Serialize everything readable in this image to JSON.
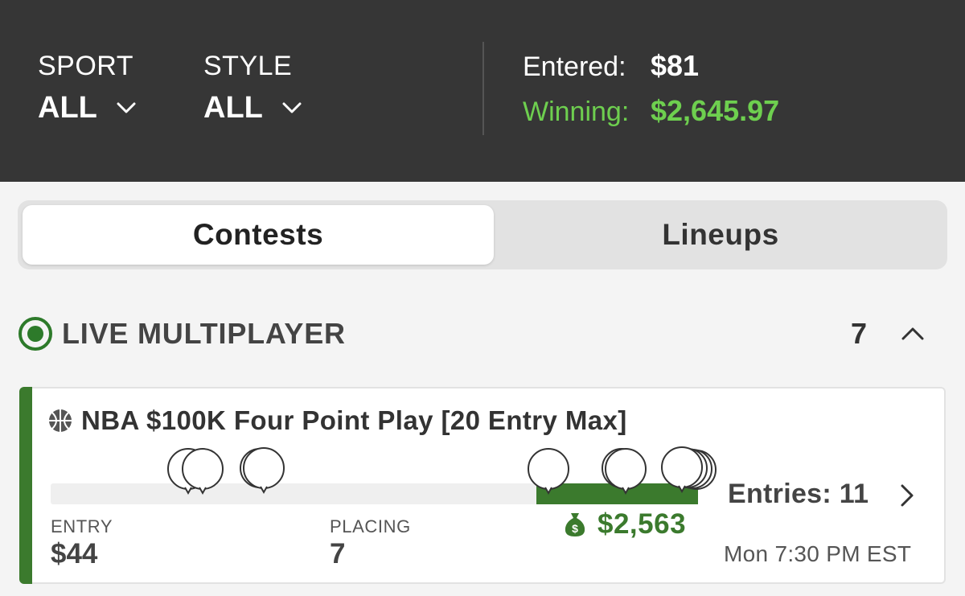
{
  "filters": {
    "sport": {
      "label": "SPORT",
      "value": "ALL",
      "icon": "chevron-down-icon"
    },
    "style": {
      "label": "STYLE",
      "value": "ALL",
      "icon": "chevron-down-icon"
    }
  },
  "totals": {
    "entered_label": "Entered:",
    "entered_value": "$81",
    "winning_label": "Winning:",
    "winning_value": "$2,645.97"
  },
  "tabs": [
    {
      "label": "Contests",
      "active": true
    },
    {
      "label": "Lineups",
      "active": false
    }
  ],
  "section": {
    "title": "LIVE MULTIPLAYER",
    "count": "7",
    "icon": "live-indicator-icon",
    "collapse_icon": "chevron-up-icon"
  },
  "contest": {
    "sport_icon": "basketball-icon",
    "title": "NBA $100K Four Point Play [20 Entry Max]",
    "winning_fraction": 0.25,
    "prize": "$2,563",
    "prize_icon": "money-bag-icon",
    "entries": "Entries: 11",
    "entry_label": "ENTRY",
    "entry_value": "$44",
    "placing_label": "PLACING",
    "placing_value": "7",
    "start_time": "Mon 7:30 PM EST"
  },
  "colors": {
    "header_bg": "#363636",
    "winning_green": "#6ecf4f",
    "brand_green": "#3b7a2d"
  }
}
